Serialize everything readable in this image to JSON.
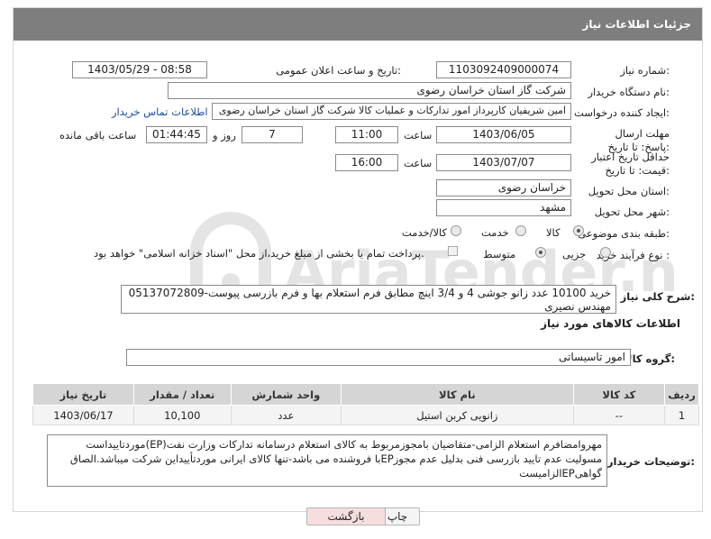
{
  "header": {
    "title": "جزئیات اطلاعات نیاز"
  },
  "form": {
    "need_number_label": "شماره نیاز:",
    "need_number": "1103092409000074",
    "announce_label": "تاریخ و ساعت اعلان عمومی:",
    "announce_value": "1403/05/29 - 08:58",
    "buyer_org_label": "نام دستگاه خریدار:",
    "buyer_org": "شرکت گاز استان خراسان رضوی",
    "requester_label": "ایجاد کننده درخواست:",
    "requester": "امین شریفیان کارپرداز امور تدارکات و عملیات کالا شرکت گاز استان خراسان رضوی",
    "contact_link": "اطلاعات تماس خریدار",
    "deadline_label": "مهلت ارسال پاسخ: تا تاریخ:",
    "deadline_date": "1403/06/05",
    "time_label": "ساعت",
    "deadline_time": "11:00",
    "days_value": "7",
    "days_label": "روز و",
    "remaining_time": "01:44:45",
    "remaining_label": "ساعت باقی مانده",
    "validity_label": "حداقل تاریخ اعتبار قیمت: تا تاریخ:",
    "validity_date": "1403/07/07",
    "validity_time": "16:00",
    "province_label": "استان محل تحویل:",
    "province": "خراسان رضوی",
    "city_label": "شهر محل تحویل:",
    "city": "مشهد",
    "category_label": "طبقه بندی موضوعی:",
    "category_options": [
      "کالا",
      "خدمت",
      "کالا/خدمت"
    ],
    "process_label": "نوع فرآیند خرید :",
    "process_options": [
      "جزیی",
      "متوسط"
    ],
    "payment_note": "پرداخت تمام یا بخشی از مبلغ خرید،از محل \"اسناد خزانه اسلامی\" خواهد بود."
  },
  "description": {
    "label": "شرح کلی نیاز:",
    "text": "خرید 10100 عدد زانو جوشی 4 و 3/4 اینچ مطابق فرم استعلام بها و فرم بازرسی پیوست-05137072809 مهندس نصیری"
  },
  "goods": {
    "section_title": "اطلاعات کالاهای مورد نیاز",
    "group_label": "گروه کالا:",
    "group_value": "امور تاسیساتی",
    "columns": [
      "ردیف",
      "کد کالا",
      "نام کالا",
      "واحد شمارش",
      "تعداد / مقدار",
      "تاریخ نیاز"
    ],
    "rows": [
      {
        "row": "1",
        "code": "--",
        "name": "زانویی کربن استیل",
        "unit": "عدد",
        "qty": "10,100",
        "date": "1403/06/17"
      }
    ]
  },
  "buyer_notes": {
    "label": "توضیحات خریدار:",
    "text": "مهروامضافرم استعلام الزامی-متقاضیان بامجوزمربوط به کالای استعلام درسامانه تدارکات وزارت نفت(EP)موردتاییداست مسولیت عدم تایید بازرسی فنی بدلیل عدم مجوزEPبا فروشنده می باشد-تنها کالای ایرانی موردتأییداین شرکت میباشد.الصاق گواهیEPالزامیست"
  },
  "buttons": {
    "print": "چاپ",
    "back": "بازگشت"
  },
  "watermark": {
    "text": "AriaTender.neT"
  },
  "colors": {
    "header_bg": "#7e7e7e",
    "link": "#1a4fa0",
    "back_btn_bg": "#f6dede",
    "watermark": "#e2e2e2"
  }
}
